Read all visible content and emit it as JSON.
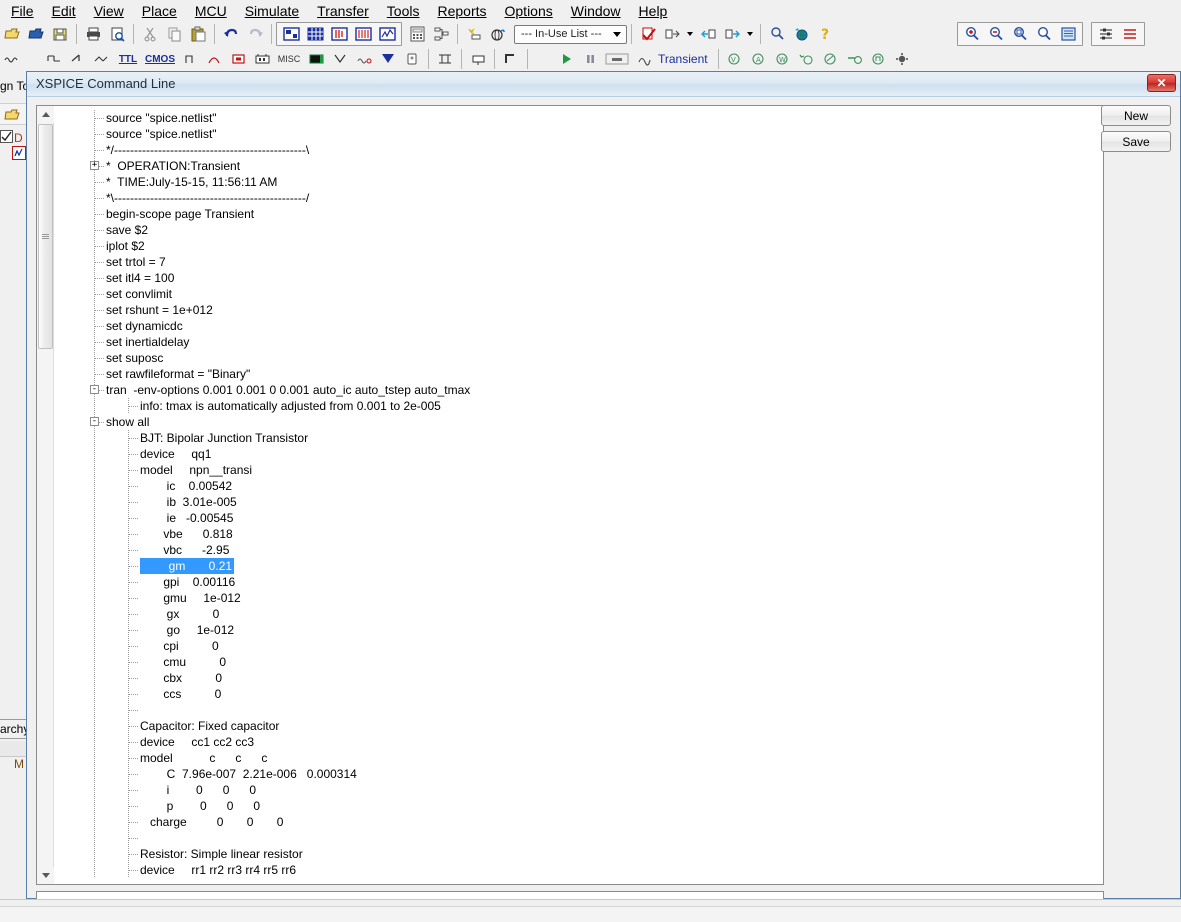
{
  "app": {
    "menubar": [
      "File",
      "Edit",
      "View",
      "Place",
      "MCU",
      "Simulate",
      "Transfer",
      "Tools",
      "Reports",
      "Options",
      "Window",
      "Help"
    ],
    "toolbar1": {
      "icons": [
        "new-file-icon",
        "open-folder-icon",
        "save-disk-icon",
        "print-icon",
        "print-preview-icon",
        "cut-icon",
        "copy-icon",
        "paste-icon",
        "undo-icon",
        "redo-icon",
        "schematic-view-icon",
        "grid-view-icon",
        "pcb-view-icon",
        "spreadsheet-icon",
        "graph-icon",
        "calculator-icon",
        "hierarchy-icon",
        "new-component-icon",
        "database-icon"
      ],
      "inuse_list": "--- In-Use List ---",
      "right_icons": [
        "erc-check-icon",
        "back-annotate-icon",
        "forward-annotate-icon",
        "transfer-icon",
        "find-icon",
        "globe-icon",
        "help-icon",
        "zoom-in-icon",
        "zoom-out-icon",
        "zoom-area-icon",
        "zoom-fit-icon",
        "zoom-sheet-icon",
        "toggle-pins-icon",
        "toggle-nets-icon"
      ]
    },
    "toolbar2": {
      "left_icons": [
        "source-icon",
        "basic-icon",
        "diode-icon",
        "transistor-icon",
        "ttl-icon",
        "cmos-icon",
        "misc-digital-icon",
        "mixed-icon",
        "indicator-icon",
        "power-icon",
        "misc-icon",
        "rf-icon",
        "electromech-icon",
        "ni-icon",
        "connector-icon",
        "mcu-icon",
        "ladder-icon",
        "bus-icon",
        "hierarchy-block-icon"
      ],
      "run_label": "Transient",
      "run_icons": [
        "run-icon",
        "pause-icon",
        "stop-icon",
        "analysis-icon"
      ],
      "right_icons": [
        "voltage-probe-icon",
        "current-probe-icon",
        "measure-icon",
        "add-probe-icon",
        "power-probe-icon",
        "differential-icon",
        "digital-probe-icon",
        "probe-settings-icon"
      ]
    }
  },
  "toolbox": {
    "title": "gn To",
    "open_icon": "open-folder-icon",
    "design_label": "D",
    "sheet_icon": "schematic-sheet-icon",
    "tab_label": "archy",
    "item_label": "M"
  },
  "dialog": {
    "title": "XSPICE Command Line",
    "close_label": "✕",
    "buttons": {
      "new": "New",
      "save": "Save"
    },
    "command_input_value": "",
    "command_input_placeholder": "",
    "scrollbar": {
      "up_icon": "scroll-up-icon",
      "down_icon": "scroll-down-icon",
      "thumb": "scroll-thumb"
    },
    "tree": [
      {
        "indent": 1,
        "expander": "",
        "text": "source \"spice.netlist\"",
        "selected": false
      },
      {
        "indent": 1,
        "expander": "",
        "text": "source \"spice.netlist\"",
        "selected": false
      },
      {
        "indent": 1,
        "expander": "",
        "text": "*/------------------------------------------------\\",
        "selected": false
      },
      {
        "indent": 1,
        "expander": "+",
        "text": "*  OPERATION:Transient",
        "selected": false
      },
      {
        "indent": 1,
        "expander": "",
        "text": "*  TIME:July-15-15, 11:56:11 AM",
        "selected": false
      },
      {
        "indent": 1,
        "expander": "",
        "text": "*\\------------------------------------------------/",
        "selected": false
      },
      {
        "indent": 1,
        "expander": "",
        "text": "begin-scope page Transient",
        "selected": false
      },
      {
        "indent": 1,
        "expander": "",
        "text": "save $2",
        "selected": false
      },
      {
        "indent": 1,
        "expander": "",
        "text": "iplot $2",
        "selected": false
      },
      {
        "indent": 1,
        "expander": "",
        "text": "set trtol = 7",
        "selected": false
      },
      {
        "indent": 1,
        "expander": "",
        "text": "set itl4 = 100",
        "selected": false
      },
      {
        "indent": 1,
        "expander": "",
        "text": "set convlimit",
        "selected": false
      },
      {
        "indent": 1,
        "expander": "",
        "text": "set rshunt = 1e+012",
        "selected": false
      },
      {
        "indent": 1,
        "expander": "",
        "text": "set dynamicdc",
        "selected": false
      },
      {
        "indent": 1,
        "expander": "",
        "text": "set inertialdelay",
        "selected": false
      },
      {
        "indent": 1,
        "expander": "",
        "text": "set suposc",
        "selected": false
      },
      {
        "indent": 1,
        "expander": "",
        "text": "set rawfileformat = \"Binary\"",
        "selected": false
      },
      {
        "indent": 1,
        "expander": "-",
        "text": "tran  -env-options 0.001 0.001 0 0.001 auto_ic auto_tstep auto_tmax",
        "selected": false
      },
      {
        "indent": 2,
        "expander": "",
        "text": "info: tmax is automatically adjusted from 0.001 to 2e-005",
        "selected": false
      },
      {
        "indent": 1,
        "expander": "-",
        "text": "show all",
        "selected": false
      },
      {
        "indent": 2,
        "expander": "",
        "text": "BJT: Bipolar Junction Transistor",
        "selected": false
      },
      {
        "indent": 2,
        "expander": "",
        "text": "device     qq1",
        "selected": false
      },
      {
        "indent": 2,
        "expander": "",
        "text": "model     npn__transi",
        "selected": false
      },
      {
        "indent": 2,
        "expander": "",
        "text": "        ic    0.00542",
        "selected": false
      },
      {
        "indent": 2,
        "expander": "",
        "text": "        ib  3.01e-005",
        "selected": false
      },
      {
        "indent": 2,
        "expander": "",
        "text": "        ie   -0.00545",
        "selected": false
      },
      {
        "indent": 2,
        "expander": "",
        "text": "       vbe      0.818",
        "selected": false
      },
      {
        "indent": 2,
        "expander": "",
        "text": "       vbc      -2.95",
        "selected": false
      },
      {
        "indent": 2,
        "expander": "",
        "text": "        gm       0.21",
        "selected": true
      },
      {
        "indent": 2,
        "expander": "",
        "text": "       gpi    0.00116",
        "selected": false
      },
      {
        "indent": 2,
        "expander": "",
        "text": "       gmu     1e-012",
        "selected": false
      },
      {
        "indent": 2,
        "expander": "",
        "text": "        gx          0",
        "selected": false
      },
      {
        "indent": 2,
        "expander": "",
        "text": "        go     1e-012",
        "selected": false
      },
      {
        "indent": 2,
        "expander": "",
        "text": "       cpi          0",
        "selected": false
      },
      {
        "indent": 2,
        "expander": "",
        "text": "       cmu          0",
        "selected": false
      },
      {
        "indent": 2,
        "expander": "",
        "text": "       cbx          0",
        "selected": false
      },
      {
        "indent": 2,
        "expander": "",
        "text": "       ccs          0",
        "selected": false
      },
      {
        "indent": 2,
        "expander": "",
        "text": "",
        "selected": false
      },
      {
        "indent": 2,
        "expander": "",
        "text": "Capacitor: Fixed capacitor",
        "selected": false
      },
      {
        "indent": 2,
        "expander": "",
        "text": "device     cc1 cc2 cc3",
        "selected": false
      },
      {
        "indent": 2,
        "expander": "",
        "text": "model           c      c      c",
        "selected": false
      },
      {
        "indent": 2,
        "expander": "",
        "text": "        C  7.96e-007  2.21e-006   0.000314",
        "selected": false
      },
      {
        "indent": 2,
        "expander": "",
        "text": "        i        0      0      0",
        "selected": false
      },
      {
        "indent": 2,
        "expander": "",
        "text": "        p        0      0      0",
        "selected": false
      },
      {
        "indent": 2,
        "expander": "",
        "text": "   charge         0       0       0",
        "selected": false
      },
      {
        "indent": 2,
        "expander": "",
        "text": "",
        "selected": false
      },
      {
        "indent": 2,
        "expander": "",
        "text": "Resistor: Simple linear resistor",
        "selected": false
      },
      {
        "indent": 2,
        "expander": "",
        "text": "device     rr1 rr2 rr3 rr4 rr5 rr6",
        "selected": false
      }
    ]
  },
  "colors": {
    "selection_blue": "#3399ff",
    "title_gradient_start": "#e9f0f7",
    "title_gradient_end": "#cfe0ee",
    "close_red": "#d9382f",
    "dialog_border": "#5a7fa6"
  }
}
